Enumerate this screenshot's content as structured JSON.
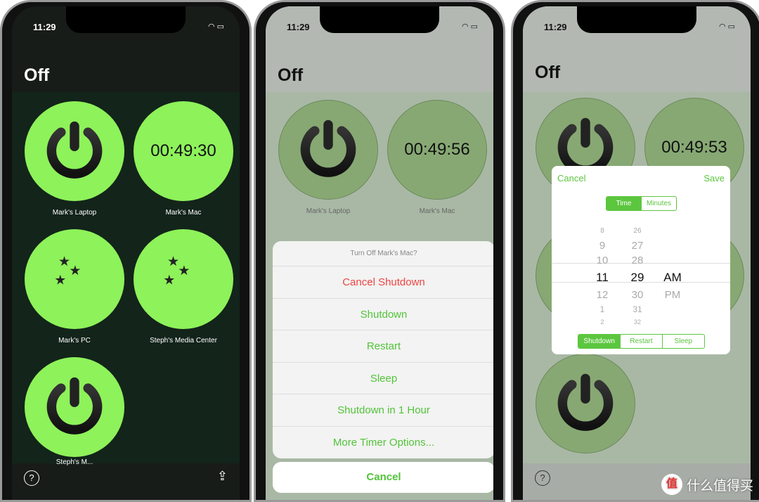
{
  "status": {
    "time": "11:29",
    "icons": "wifi-battery"
  },
  "screen": {
    "title": "Off"
  },
  "devices": [
    {
      "name": "Mark's Laptop",
      "icon": "power-icon"
    },
    {
      "name": "Mark's Mac",
      "icon": "timer",
      "phone1_timer": "00:49:30",
      "phone2_timer": "00:49:56",
      "phone3_timer": "00:49:53"
    },
    {
      "name": "Mark's PC",
      "icon": "moon-icon"
    },
    {
      "name": "Steph's Media Center",
      "icon": "moon-icon"
    },
    {
      "name": "Steph's M...",
      "icon": "power-icon"
    }
  ],
  "toolbar": {
    "help": "?",
    "share": "⇪"
  },
  "action_sheet": {
    "title": "Turn Off Mark's Mac?",
    "items": [
      "Cancel Shutdown",
      "Shutdown",
      "Restart",
      "Sleep",
      "Shutdown in 1 Hour",
      "More Timer Options..."
    ],
    "cancel": "Cancel"
  },
  "timer_dialog": {
    "cancel": "Cancel",
    "save": "Save",
    "mode_tabs": [
      "Time",
      "Minutes"
    ],
    "mode_selected": "Time",
    "hours": [
      "8",
      "9",
      "10",
      "11",
      "12",
      "1",
      "2"
    ],
    "minutes": [
      "26",
      "27",
      "28",
      "29",
      "30",
      "31",
      "32"
    ],
    "ampm": [
      "AM",
      "PM"
    ],
    "selected": {
      "hour": "11",
      "minute": "29",
      "ampm": "AM"
    },
    "action_tabs": [
      "Shutdown",
      "Restart",
      "Sleep"
    ],
    "action_selected": "Shutdown"
  },
  "colors": {
    "accent": "#8ef25a",
    "bg": "#13241a",
    "link": "#53c33a"
  },
  "watermark": {
    "logo": "值",
    "text": "什么值得买"
  }
}
